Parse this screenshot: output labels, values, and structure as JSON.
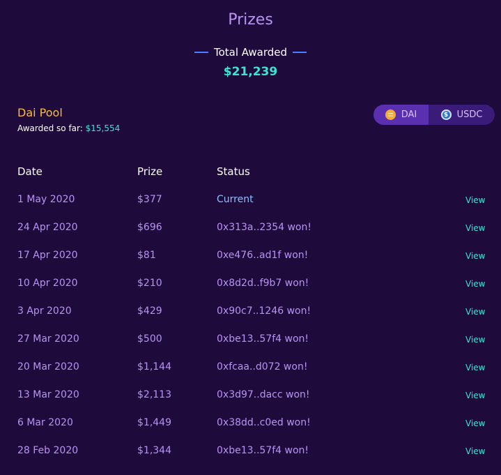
{
  "title": "Prizes",
  "total": {
    "label": "Total Awarded",
    "value": "$21,239"
  },
  "pool": {
    "name": "Dai Pool",
    "awarded_label": "Awarded so far:",
    "awarded_value": "$15,554"
  },
  "tokens": {
    "dai": "DAI",
    "usdc": "USDC",
    "selected": "DAI"
  },
  "table": {
    "headers": {
      "date": "Date",
      "prize": "Prize",
      "status": "Status"
    },
    "view_label": "View",
    "rows": [
      {
        "date": "1 May 2020",
        "prize": "$377",
        "status": "Current"
      },
      {
        "date": "24 Apr 2020",
        "prize": "$696",
        "status": "0x313a..2354 won!"
      },
      {
        "date": "17 Apr 2020",
        "prize": "$81",
        "status": "0xe476..ad1f won!"
      },
      {
        "date": "10 Apr 2020",
        "prize": "$210",
        "status": "0x8d2d..f9b7 won!"
      },
      {
        "date": "3 Apr 2020",
        "prize": "$429",
        "status": "0x90c7..1246 won!"
      },
      {
        "date": "27 Mar 2020",
        "prize": "$500",
        "status": "0xbe13..57f4 won!"
      },
      {
        "date": "20 Mar 2020",
        "prize": "$1,144",
        "status": "0xfcaa..d072 won!"
      },
      {
        "date": "13 Mar 2020",
        "prize": "$2,113",
        "status": "0x3d97..dacc won!"
      },
      {
        "date": "6 Mar 2020",
        "prize": "$1,449",
        "status": "0x38dd..c0ed won!"
      },
      {
        "date": "28 Feb 2020",
        "prize": "$1,344",
        "status": "0xbe13..57f4 won!"
      }
    ]
  },
  "colors": {
    "background": "#1e0b3b",
    "accent_teal": "#3ce5d1",
    "accent_purple": "#b893f3",
    "pool_name": "#ffbb33"
  }
}
